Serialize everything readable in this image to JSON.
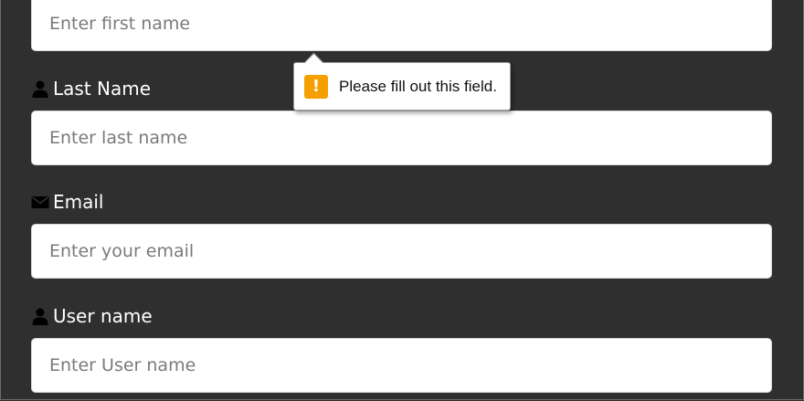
{
  "form": {
    "first_name": {
      "placeholder": "Enter first name"
    },
    "last_name": {
      "label": "Last Name",
      "placeholder": "Enter last name",
      "icon": "user-icon"
    },
    "email": {
      "label": "Email",
      "placeholder": "Enter your email",
      "icon": "envelope-icon"
    },
    "username": {
      "label": "User name",
      "placeholder": "Enter User name",
      "icon": "user-icon"
    }
  },
  "validation_tooltip": {
    "message": "Please fill out this field.",
    "icon": "warning-icon",
    "icon_symbol": "!",
    "accent_color": "#f5a000"
  },
  "colors": {
    "background": "#2f2f2f",
    "field_background": "#ffffff",
    "label_text": "#ffffff"
  }
}
